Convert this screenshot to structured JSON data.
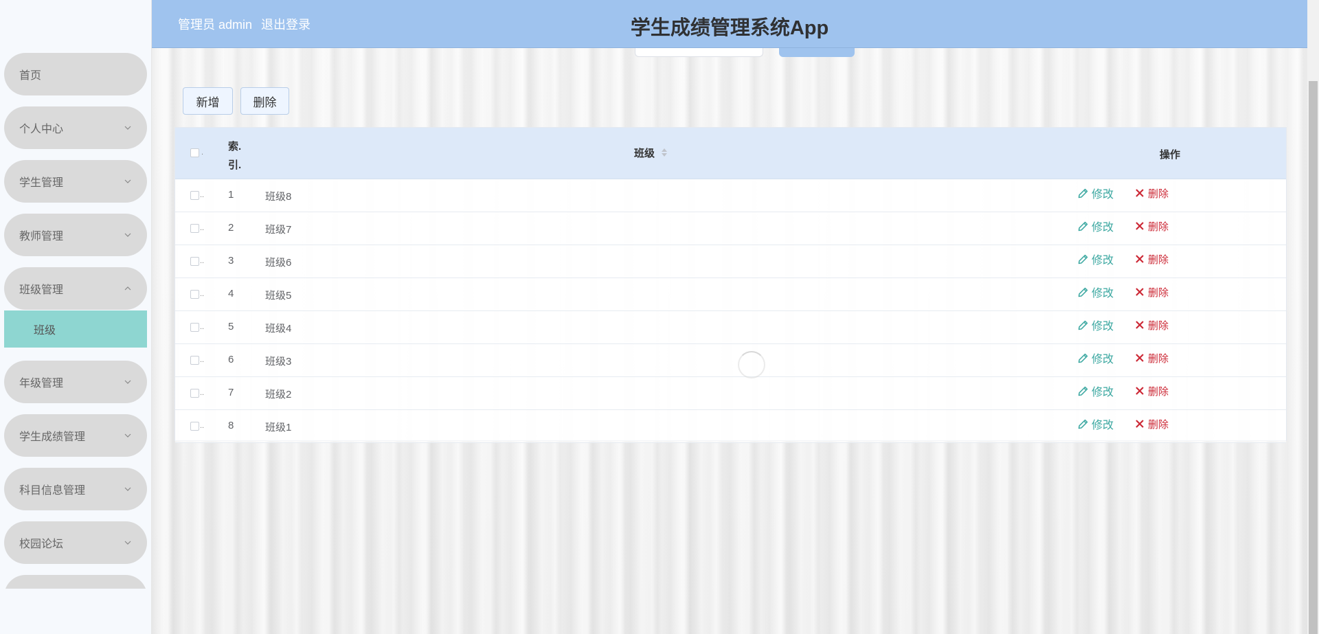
{
  "header": {
    "user_label": "管理员 admin",
    "logout_label": "退出登录",
    "title": "学生成绩管理系统App"
  },
  "sidebar": {
    "items": [
      {
        "label": "首页",
        "has_chevron": false
      },
      {
        "label": "个人中心",
        "has_chevron": true,
        "chevron": "chevron-down-icon"
      },
      {
        "label": "学生管理",
        "has_chevron": true,
        "chevron": "chevron-down-icon"
      },
      {
        "label": "教师管理",
        "has_chevron": true,
        "chevron": "chevron-down-icon"
      },
      {
        "label": "班级管理",
        "has_chevron": true,
        "chevron": "chevron-up-icon",
        "expanded": true
      },
      {
        "label": "年级管理",
        "has_chevron": true,
        "chevron": "chevron-down-icon"
      },
      {
        "label": "学生成绩管理",
        "has_chevron": true,
        "chevron": "chevron-down-icon"
      },
      {
        "label": "科目信息管理",
        "has_chevron": true,
        "chevron": "chevron-down-icon"
      },
      {
        "label": "校园论坛",
        "has_chevron": true,
        "chevron": "chevron-down-icon"
      }
    ],
    "active_sub_item": {
      "label": "班级",
      "parent": "班级管理"
    }
  },
  "toolbar": {
    "add_label": "新增",
    "delete_label": "删除"
  },
  "table": {
    "header_checkbox_suffix": ".",
    "index_header": "索.引.",
    "index_header_lines": [
      "索.",
      "引."
    ],
    "class_header": "班级",
    "ops_header": "操作",
    "row_checkbox_suffix": "..",
    "edit_label": "修改",
    "delete_label": "删除",
    "rows": [
      {
        "index": "1",
        "class": "班级8"
      },
      {
        "index": "2",
        "class": "班级7"
      },
      {
        "index": "3",
        "class": "班级6"
      },
      {
        "index": "4",
        "class": "班级5"
      },
      {
        "index": "5",
        "class": "班级4"
      },
      {
        "index": "6",
        "class": "班级3"
      },
      {
        "index": "7",
        "class": "班级2"
      },
      {
        "index": "8",
        "class": "班级1"
      }
    ]
  },
  "colors": {
    "header_bg": "#9fc3ee",
    "nav_item_bg": "#dadada",
    "active_sub_bg": "#8ed6d1",
    "table_header_bg": "#dde9f9",
    "edit_color": "#3aa7a0",
    "delete_color": "#cc2936"
  },
  "icons": {
    "edit": "edit-pencil-icon",
    "delete": "close-x-icon",
    "sort": "sort-caret-icon",
    "loading": "loading-spinner-icon"
  }
}
